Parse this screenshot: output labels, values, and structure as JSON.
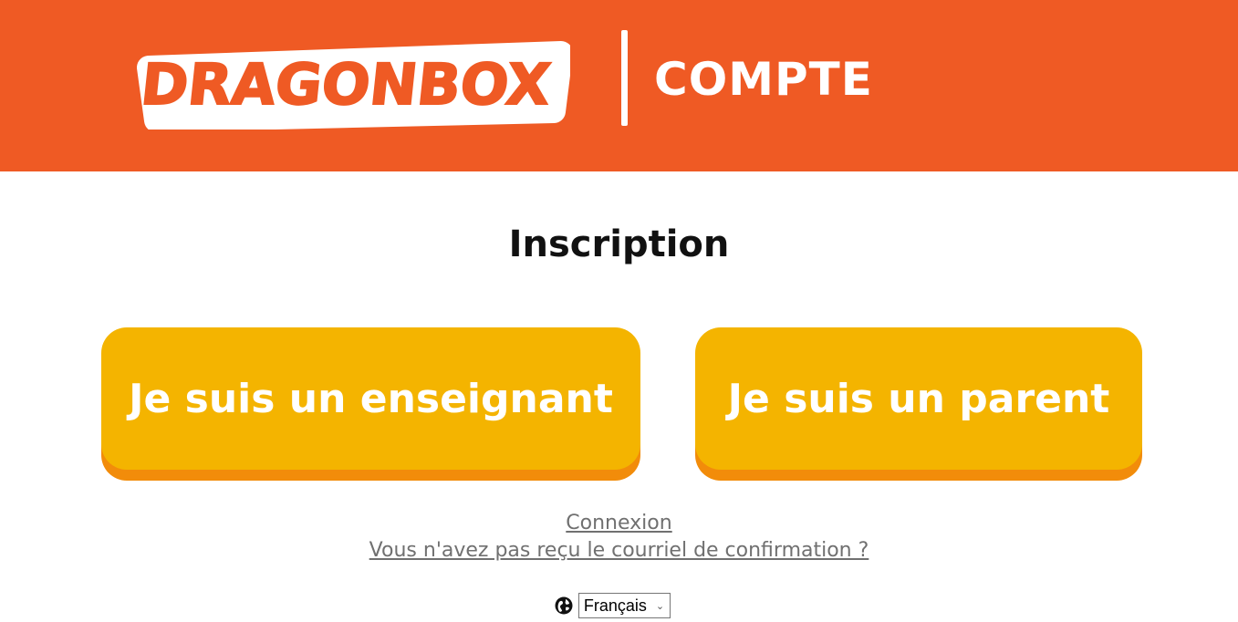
{
  "colors": {
    "brand": "#ef5a24",
    "button": "#f4b400",
    "button_shadow": "#f28c0a",
    "link": "#707070"
  },
  "header": {
    "logo_text": "DRAGONBOX",
    "title": "COMPTE"
  },
  "page": {
    "title": "Inscription"
  },
  "roles": {
    "teacher_label": "Je suis un enseignant",
    "parent_label": "Je suis un parent"
  },
  "links": {
    "login": "Connexion",
    "resend_confirmation": "Vous n'avez pas reçu le courriel de confirmation ?"
  },
  "language": {
    "icon": "globe-icon",
    "selected": "Français"
  }
}
